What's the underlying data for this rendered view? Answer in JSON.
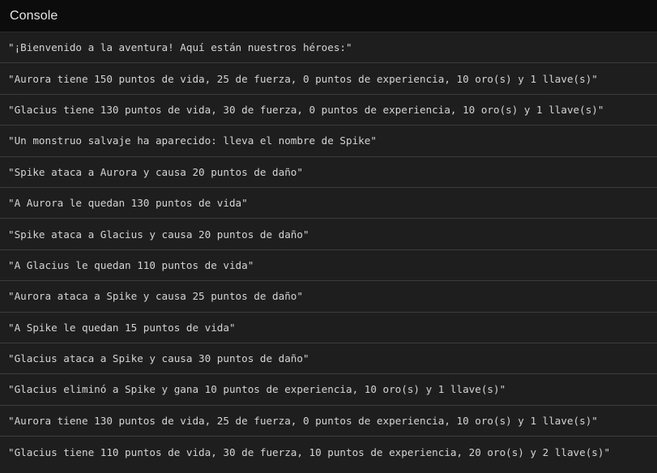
{
  "console": {
    "title": "Console",
    "entries": [
      "\"¡Bienvenido a la aventura! Aquí están nuestros héroes:\"",
      "\"Aurora tiene 150 puntos de vida, 25 de fuerza, 0 puntos de experiencia, 10 oro(s) y 1 llave(s)\"",
      "\"Glacius tiene 130 puntos de vida, 30 de fuerza, 0 puntos de experiencia, 10 oro(s) y 1 llave(s)\"",
      "\"Un monstruo salvaje ha aparecido: lleva el nombre de Spike\"",
      "\"Spike ataca a Aurora y causa 20 puntos de daño\"",
      "\"A Aurora le quedan 130 puntos de vida\"",
      "\"Spike ataca a Glacius y causa 20 puntos de daño\"",
      "\"A Glacius le quedan 110 puntos de vida\"",
      "\"Aurora ataca a Spike y causa 25 puntos de daño\"",
      "\"A Spike le quedan 15 puntos de vida\"",
      "\"Glacius ataca a Spike y causa 30 puntos de daño\"",
      "\"Glacius eliminó a Spike y gana 10 puntos de experiencia, 10 oro(s) y 1 llave(s)\"",
      "\"Aurora tiene 130 puntos de vida, 25 de fuerza, 0 puntos de experiencia, 10 oro(s) y 1 llave(s)\"",
      "\"Glacius tiene 110 puntos de vida, 30 de fuerza, 10 puntos de experiencia, 20 oro(s) y 2 llave(s)\""
    ]
  }
}
